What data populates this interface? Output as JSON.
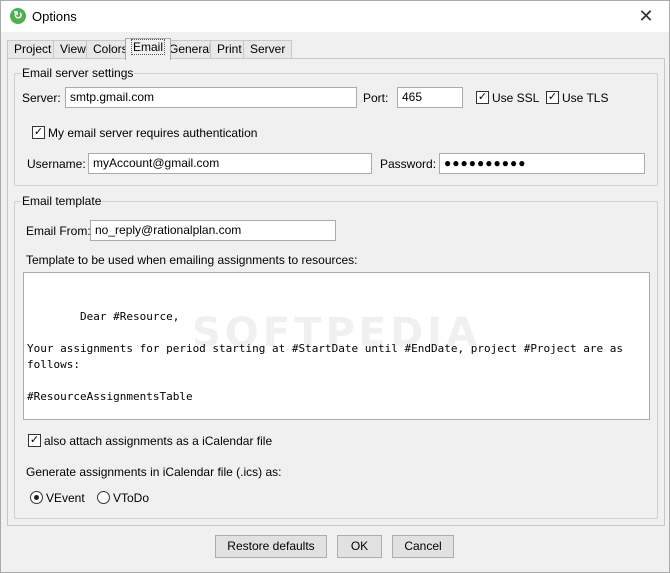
{
  "window": {
    "title": "Options",
    "app_icon": "rationalplan-icon",
    "close_glyph": "✕"
  },
  "tabs": [
    {
      "label": "Project",
      "active": false
    },
    {
      "label": "View",
      "active": false
    },
    {
      "label": "Colors",
      "active": false
    },
    {
      "label": "Email",
      "active": true
    },
    {
      "label": "General",
      "active": false
    },
    {
      "label": "Print",
      "active": false
    },
    {
      "label": "Server",
      "active": false
    }
  ],
  "server_settings": {
    "group_title": "Email server settings",
    "server_label": "Server:",
    "server_value": "smtp.gmail.com",
    "port_label": "Port:",
    "port_value": "465",
    "use_ssl_label": "Use SSL",
    "use_ssl_checked": true,
    "use_tls_label": "Use TLS",
    "use_tls_checked": true,
    "auth_label": "My email server requires authentication",
    "auth_checked": true,
    "username_label": "Username:",
    "username_value": "myAccount@gmail.com",
    "password_label": "Password:",
    "password_value": "●●●●●●●●●●"
  },
  "template": {
    "group_title": "Email template",
    "from_label": "Email From:",
    "from_value": "no_reply@rationalplan.com",
    "body_label": "Template to be used when emailing assignments to resources:",
    "body_text": "Dear #Resource,\n\nYour assignments for period starting at #StartDate until #EndDate, project #Project are as follows:\n\n#ResourceAssignmentsTable",
    "watermark": "SOFTPEDIA",
    "ical_label": "also attach assignments as a iCalendar file",
    "ical_checked": true,
    "format_label": "Generate assignments in iCalendar file (.ics) as:",
    "format_options": [
      {
        "label": "VEvent",
        "selected": true
      },
      {
        "label": "VToDo",
        "selected": false
      }
    ]
  },
  "footer": {
    "restore_label": "Restore defaults",
    "ok_label": "OK",
    "cancel_label": "Cancel"
  },
  "check_glyph": "✓"
}
